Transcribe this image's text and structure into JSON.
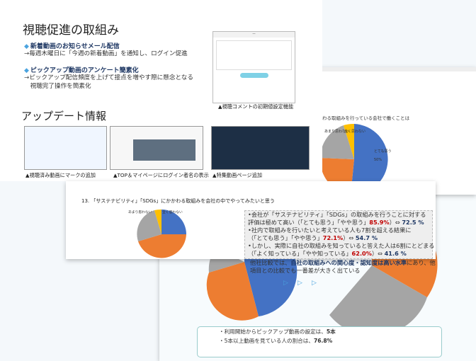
{
  "left_slide": {
    "title": "視聴促進の取組み",
    "bullets": [
      {
        "head": "新着動画のお知らせメール配信",
        "body": [
          "→毎週木曜日に「今週の新着動画」を通知し、ログイン促進"
        ]
      },
      {
        "head": "ピックアップ動画のアンケート簡素化",
        "body": [
          "→ピックアップ配信頻度を上げて接点を増やす際に懸念となる",
          "　視聴完了操作を簡素化"
        ]
      }
    ],
    "mock_caption": "▲視聴コメントの初期値設定機能",
    "update_title": "アップデート情報",
    "thumb_captions": [
      "▲視聴済み動画にマークの追加",
      "▲TOP＆マイページにログイン者名の表示",
      "▲特集動画ページ追加"
    ]
  },
  "right_slide": {
    "question": "かかわる取組みを行っている会社で働くことは",
    "pie_labels": [
      "とても思う",
      "やや思う",
      "あまり思わない",
      "全く思わない"
    ],
    "pie_values": [
      50,
      32,
      13,
      1
    ]
  },
  "mid_slide": {
    "question": "13. 「サステナビリティ」「SDGs」にかかわる取組みを会社の中でやってみたいと思う",
    "pie_values": [
      20,
      46,
      28,
      2,
      1
    ],
    "pie_labels": [
      "とても思う",
      "やや思う",
      "あまり思わない",
      "全く思わない"
    ],
    "summary": {
      "l1": "•会社が「サステナビリティ」「SDGs」の取組みを行うことに対する",
      "l2a": "  評価は極めて高い（「とても思う」「やや思う」",
      "l2v": "85.9%",
      "l2b": "）⇔ ",
      "l2c": "72.5 %",
      "l3": "•社内で取組みを行いたいと考えている人も7割を超える結果に",
      "l4a": "  （「とても思う」「やや思う」",
      "l4v": "72.1%",
      "l4b": "）⇔ ",
      "l4c": "54.7 %",
      "l5": "•しかし、実際に自社の取組みを知っていると答えた人は6割にとどまる",
      "l6a": "  （「よく知っている」「やや知っている」",
      "l6v": "62.0%",
      "l6b": "）⇔ ",
      "l6c": "41.6 %",
      "l7a": "他社比較では、",
      "l7v": "自社の取組みへの関心度・認知度は高い水準",
      "l7b": "にあり、他",
      "l8": "項目との比較でも一番差が大きく出ている"
    }
  },
  "bottom_slide": {
    "notes": [
      {
        "text": "・利用開始からピックアップ動画の設定は、",
        "value": "5本"
      },
      {
        "text": "・5本以上動画を見ている人の割合は、",
        "value": "76.8%"
      }
    ]
  },
  "colors": {
    "blue": "#4472c4",
    "orange": "#ed7d31",
    "gray": "#a5a5a5",
    "yellow": "#ffc000"
  }
}
